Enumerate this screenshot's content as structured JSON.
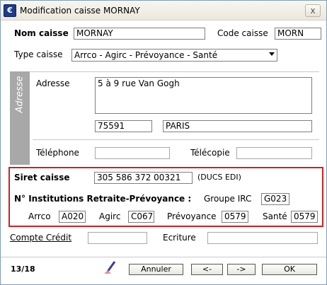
{
  "window": {
    "title": "Modification caisse MORNAY",
    "icon": "app-logo-icon",
    "close_label": "x"
  },
  "identity": {
    "nom_label": "Nom caisse",
    "nom_value": "MORNAY",
    "code_label": "Code caisse",
    "code_value": "MORN",
    "type_label": "Type caisse",
    "type_value": "Arrco - Agirc - Prévoyance - Santé"
  },
  "address": {
    "side_label": "Adresse",
    "adresse_label": "Adresse",
    "adresse_value": "5 à 9 rue Van Gogh",
    "postcode_value": "75591",
    "city_value": "PARIS",
    "telephone_label": "Téléphone",
    "telephone_value": "",
    "telecopie_label": "Télécopie",
    "telecopie_value": ""
  },
  "siret": {
    "label": "Siret caisse",
    "value": "305 586 372 00321",
    "note": "(DUCS EDI)"
  },
  "institutions": {
    "label": "N° Institutions Retraite-Prévoyance :",
    "groupe_label": "Groupe IRC",
    "groupe_value": "G023",
    "arrco_label": "Arrco",
    "arrco_value": "A020",
    "agirc_label": "Agirc",
    "agirc_value": "C067",
    "prevoyance_label": "Prévoyance",
    "prevoyance_value": "0579",
    "sante_label": "Santé",
    "sante_value": "0579"
  },
  "credit": {
    "compte_label": "Compte Crédit",
    "compte_value": "",
    "ecriture_label": "Ecriture",
    "ecriture_value": ""
  },
  "footer": {
    "counter": "13/18",
    "cancel_label": "Annuler",
    "prev_label": "<-",
    "next_label": "->",
    "ok_label": "OK"
  },
  "colors": {
    "highlight_border": "#cc2222",
    "side_strip": "#a8a8a8"
  }
}
